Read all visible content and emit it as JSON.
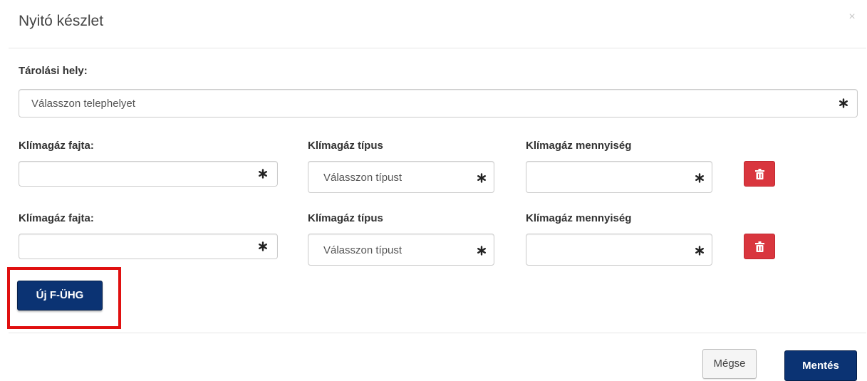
{
  "modal": {
    "title": "Nyitó készlet",
    "close_label": "×"
  },
  "storage": {
    "label": "Tárolási hely:",
    "placeholder": "Válasszon telephelyet"
  },
  "rows": [
    {
      "type_kind_label": "Klímagáz fajta:",
      "type_kind_value": "",
      "type_label": "Klímagáz típus",
      "type_placeholder": "Válasszon típust",
      "amount_label": "Klímagáz mennyiség",
      "amount_value": ""
    },
    {
      "type_kind_label": "Klímagáz fajta:",
      "type_kind_value": "",
      "type_label": "Klímagáz típus",
      "type_placeholder": "Válasszon típust",
      "amount_label": "Klímagáz mennyiség",
      "amount_value": ""
    }
  ],
  "actions": {
    "new_label": "Új F-ÜHG",
    "cancel_label": "Mégse",
    "save_label": "Mentés"
  },
  "icons": {
    "required": "asterisk-icon",
    "delete": "trash-icon",
    "close": "close-icon"
  },
  "colors": {
    "primary": "#0b3373",
    "danger": "#d9363e",
    "highlight": "#e01010"
  }
}
